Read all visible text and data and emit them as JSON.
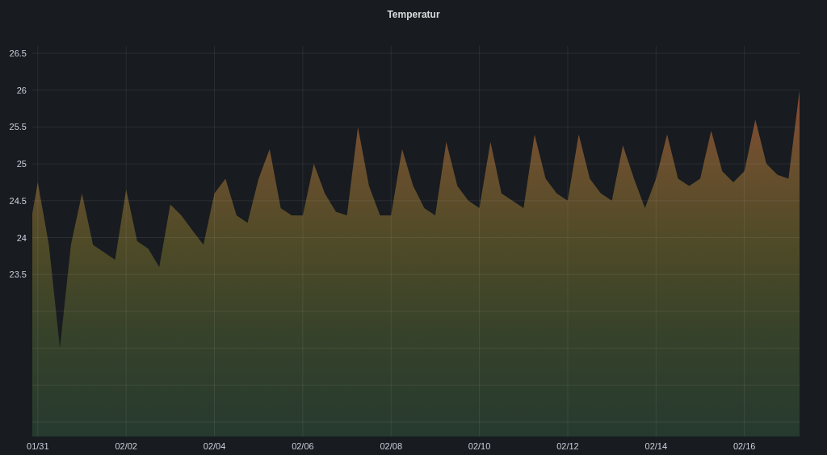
{
  "panel": {
    "title": "Temperatur",
    "chart_data": {
      "type": "area",
      "grid": true,
      "ylim": [
        21.3,
        26.6
      ],
      "yticks": [
        23.5,
        24,
        24.5,
        25,
        25.5,
        26,
        26.5
      ],
      "categories": [
        null,
        "01/31",
        null,
        null,
        null,
        null,
        null,
        null,
        null,
        "02/02",
        null,
        null,
        null,
        null,
        null,
        null,
        null,
        "02/04",
        null,
        null,
        null,
        null,
        null,
        null,
        null,
        "02/06",
        null,
        null,
        null,
        null,
        null,
        null,
        null,
        "02/08",
        null,
        null,
        null,
        null,
        null,
        null,
        null,
        "02/10",
        null,
        null,
        null,
        null,
        null,
        null,
        null,
        "02/12",
        null,
        null,
        null,
        null,
        null,
        null,
        null,
        "02/14",
        null,
        null,
        null,
        null,
        null,
        null,
        null,
        "02/16",
        null,
        null,
        null,
        null,
        null
      ],
      "series": [
        {
          "color": "#8a4a35",
          "values": [
            23.9,
            24.75,
            23.9,
            22.5,
            23.9,
            24.6,
            23.9,
            23.8,
            23.7,
            24.65,
            23.95,
            23.85,
            23.6,
            24.45,
            24.3,
            24.1,
            23.9,
            24.6,
            24.8,
            24.3,
            24.2,
            24.8,
            25.2,
            24.4,
            24.3,
            24.3,
            25.0,
            24.6,
            24.35,
            24.3,
            25.5,
            24.7,
            24.3,
            24.3,
            25.2,
            24.7,
            24.4,
            24.3,
            25.3,
            24.7,
            24.5,
            24.4,
            25.3,
            24.6,
            24.5,
            24.4,
            25.4,
            24.8,
            24.6,
            24.5,
            25.4,
            24.8,
            24.6,
            24.5,
            25.25,
            24.8,
            24.4,
            24.8,
            25.4,
            24.8,
            24.7,
            24.8,
            25.45,
            24.9,
            24.75,
            24.9,
            25.6,
            25.0,
            24.85,
            24.8,
            26.0
          ]
        }
      ]
    }
  }
}
